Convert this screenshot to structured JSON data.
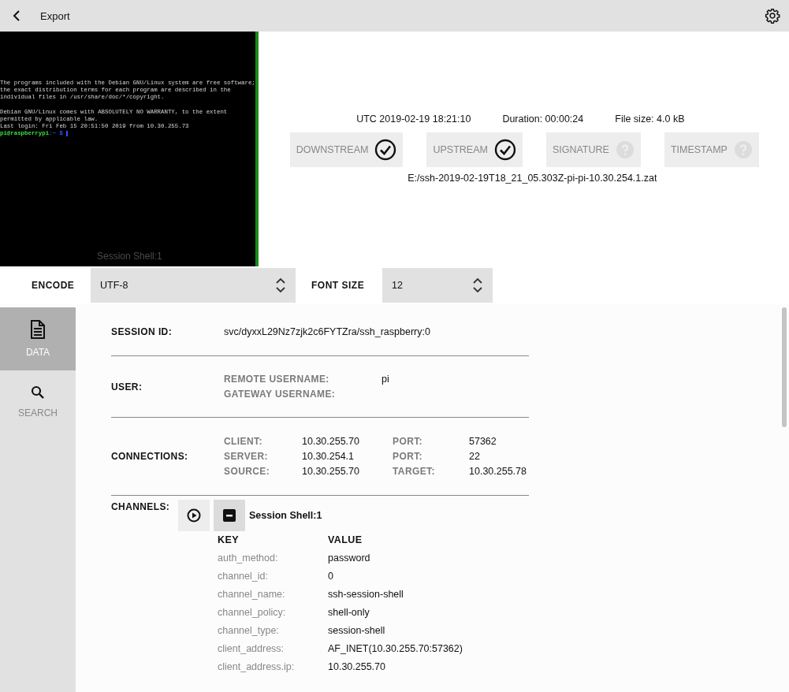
{
  "header": {
    "title": "Export"
  },
  "terminal": {
    "lines": [
      {
        "kind": "text",
        "text": "The programs included with the Debian GNU/Linux system are free software;"
      },
      {
        "kind": "text",
        "text": "the exact distribution terms for each program are described in the"
      },
      {
        "kind": "text",
        "text": "individual files in /usr/share/doc/*/copyright."
      },
      {
        "kind": "blank"
      },
      {
        "kind": "text",
        "text": "Debian GNU/Linux comes with ABSOLUTELY NO WARRANTY, to the extent"
      },
      {
        "kind": "text",
        "text": "permitted by applicable law."
      },
      {
        "kind": "text",
        "text": "Last login: Fri Feb 15 20:51:50 2019 from 10.30.255.73"
      },
      {
        "kind": "prompt",
        "user": "pi@raspberrypi",
        "path": ":~ $"
      }
    ],
    "caption": "Session Shell:1"
  },
  "info": {
    "timestamp": "UTC 2019-02-19 18:21:10",
    "duration": "Duration: 00:00:24",
    "file_size": "File size: 4.0 kB"
  },
  "checks": [
    {
      "label": "DOWNSTREAM",
      "verified": true
    },
    {
      "label": "UPSTREAM",
      "verified": true
    },
    {
      "label": "SIGNATURE",
      "verified": false
    },
    {
      "label": "TIMESTAMP",
      "verified": false
    }
  ],
  "file_path": "E:/ssh-2019-02-19T18_21_05.303Z-pi-pi-10.30.254.1.zat",
  "encode": {
    "label": "ENCODE",
    "value": "UTF-8"
  },
  "font_size": {
    "label": "FONT SIZE",
    "value": "12"
  },
  "sidebar": {
    "items": [
      {
        "kind": "data",
        "label": "DATA",
        "selected": true
      },
      {
        "kind": "search",
        "label": "SEARCH",
        "selected": false
      }
    ]
  },
  "session": {
    "label": "SESSION ID:",
    "value": "svc/dyxxL29Nz7zjk2c6FYTZra/ssh_raspberry:0"
  },
  "user": {
    "label": "USER:",
    "fields": [
      {
        "label": "REMOTE USERNAME:",
        "value": "pi"
      },
      {
        "label": "GATEWAY USERNAME:"
      }
    ]
  },
  "connections": {
    "label": "CONNECTIONS:",
    "rows": [
      {
        "label": "CLIENT:",
        "value": "10.30.255.70",
        "label2": "PORT:",
        "value2": "57362"
      },
      {
        "label": "SERVER:",
        "value": "10.30.254.1",
        "label2": "PORT:",
        "value2": "22"
      },
      {
        "label": "SOURCE:",
        "value": "10.30.255.70",
        "label2": "TARGET:",
        "value2": "10.30.255.78"
      }
    ]
  },
  "channels": {
    "label": "CHANNELS:",
    "items": [
      {
        "name": "Session Shell:1",
        "expanded": true,
        "key_heading": "KEY",
        "value_heading": "VALUE",
        "properties": [
          {
            "key": "auth_method:",
            "value": "password"
          },
          {
            "key": "channel_id:",
            "value": "0"
          },
          {
            "key": "channel_name:",
            "value": "ssh-session-shell"
          },
          {
            "key": "channel_policy:",
            "value": "shell-only"
          },
          {
            "key": "channel_type:",
            "value": "session-shell"
          },
          {
            "key": "client_address:",
            "value": "AF_INET(10.30.255.70:57362)"
          },
          {
            "key": "client_address.ip:",
            "value": "10.30.255.70"
          }
        ]
      }
    ]
  }
}
